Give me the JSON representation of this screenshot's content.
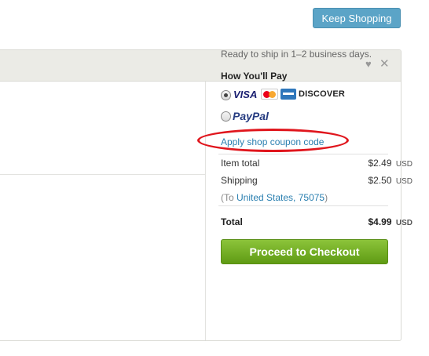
{
  "header": {
    "keep_shopping": "Keep Shopping"
  },
  "panel": {
    "ship_note": "Ready to ship in 1–2 business days.",
    "payment": {
      "title": "How You'll Pay",
      "cards_label": "VISA",
      "discover_label": "DISCOVER",
      "paypal_label": "PayPal",
      "selected": "cards"
    },
    "coupon_link": "Apply shop coupon code",
    "summary": {
      "item_total_label": "Item total",
      "item_total_value": "$2.49",
      "shipping_label": "Shipping",
      "shipping_value": "$2.50",
      "currency": "USD",
      "to_prefix": "(To ",
      "to_location": "United States, 75075",
      "to_suffix": ")",
      "total_label": "Total",
      "total_value": "$4.99"
    },
    "checkout_button": "Proceed to Checkout"
  },
  "icons": [
    "heart-icon",
    "close-icon",
    "visa-logo",
    "mastercard-icon",
    "amex-icon",
    "discover-logo",
    "paypal-logo"
  ],
  "colors": {
    "link": "#2a7fb0",
    "checkout_green": "#7bb42a",
    "keep_blue": "#5ba4c7",
    "annotation_red": "#e0161d"
  }
}
